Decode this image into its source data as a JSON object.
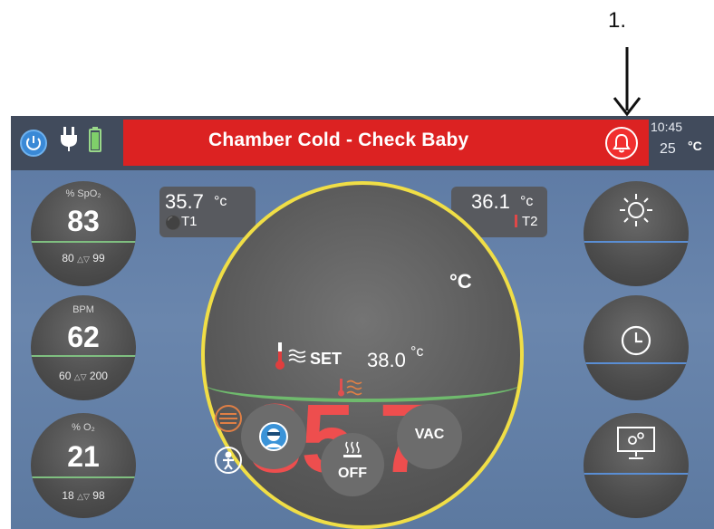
{
  "annotation": {
    "label": "1."
  },
  "topbar": {
    "icons": [
      "power-icon",
      "plug-icon",
      "battery-icon"
    ],
    "alarm_message": "Chamber Cold - Check Baby",
    "alarm_color": "#dc2222",
    "bell_icon": "bell-icon",
    "time": "10:45",
    "ambient_temp": "25",
    "ambient_unit": "°C"
  },
  "left_vitals": [
    {
      "title": "% SpO₂",
      "value": "83",
      "low": "80",
      "high": "99"
    },
    {
      "title": "BPM",
      "value": "62",
      "low": "60",
      "high": "200"
    },
    {
      "title": "% O₂",
      "value": "21",
      "low": "18",
      "high": "98"
    }
  ],
  "temps": {
    "t1_value": "35.7",
    "t1_unit": "°c",
    "t1_label": "T1",
    "t2_value": "36.1",
    "t2_unit": "°c",
    "t2_label": "T2"
  },
  "setpoint": {
    "label": "SET",
    "value": "38.0",
    "unit": "°c"
  },
  "main_temp": {
    "value": "35.7",
    "unit": "°C",
    "color": "#ee4e4e"
  },
  "bottom_buttons": {
    "heater_state": "OFF",
    "vac_label": "VAC"
  },
  "right_buttons": [
    "brightness-icon",
    "clock-icon",
    "display-settings-icon"
  ]
}
